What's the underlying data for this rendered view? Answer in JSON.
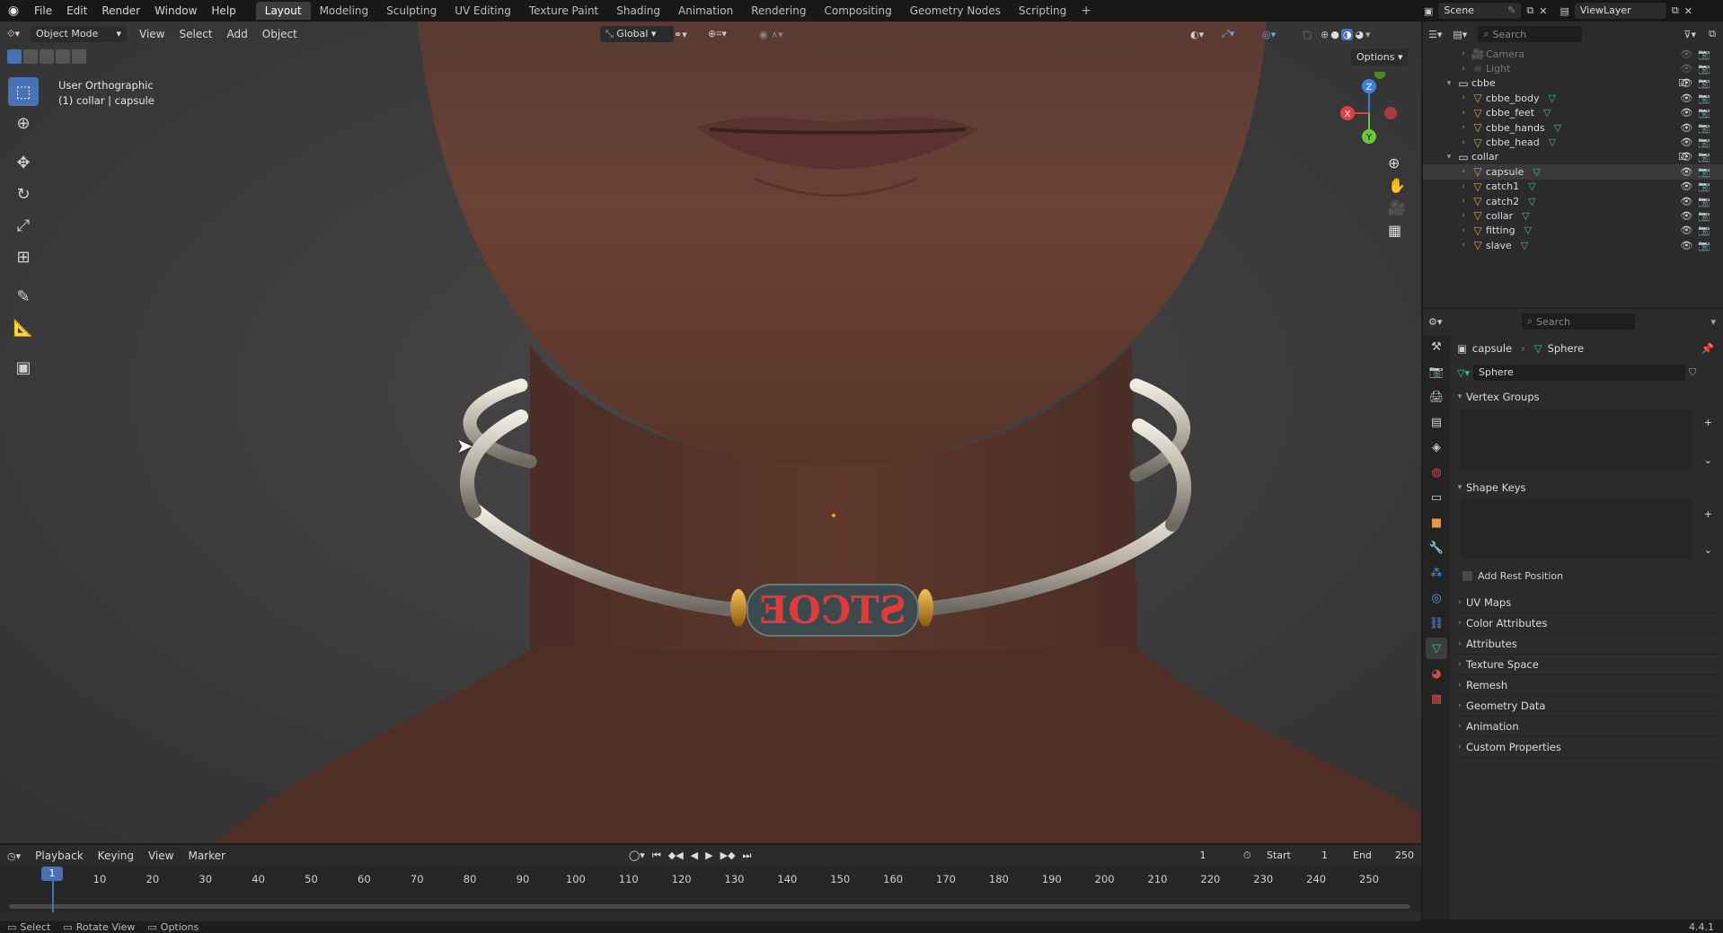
{
  "topbar": {
    "menus": [
      "File",
      "Edit",
      "Render",
      "Window",
      "Help"
    ],
    "workspaces": [
      "Layout",
      "Modeling",
      "Sculpting",
      "UV Editing",
      "Texture Paint",
      "Shading",
      "Animation",
      "Rendering",
      "Compositing",
      "Geometry Nodes",
      "Scripting"
    ],
    "active_workspace": "Layout",
    "add_tab": "+",
    "scene_label": "Scene",
    "viewlayer_label": "ViewLayer"
  },
  "viewport": {
    "mode": "Object Mode",
    "menus": [
      "View",
      "Select",
      "Add",
      "Object"
    ],
    "transform_orientation": "Global",
    "options_label": "Options",
    "view_name": "User Orthographic",
    "object_info": "(1) collar | capsule",
    "collar_text": "STCOE",
    "gizmo": {
      "x": "X",
      "y": "Y",
      "z": "Z"
    }
  },
  "outliner": {
    "search_placeholder": "Search",
    "rows": [
      {
        "label": "Camera",
        "type": "camera",
        "level": 1,
        "dim": true
      },
      {
        "label": "Light",
        "type": "light",
        "level": 1,
        "dim": true
      },
      {
        "label": "cbbe",
        "type": "collection",
        "level": 0
      },
      {
        "label": "cbbe_body",
        "type": "mesh",
        "level": 1
      },
      {
        "label": "cbbe_feet",
        "type": "mesh",
        "level": 1
      },
      {
        "label": "cbbe_hands",
        "type": "mesh",
        "level": 1
      },
      {
        "label": "cbbe_head",
        "type": "mesh",
        "level": 1
      },
      {
        "label": "collar",
        "type": "collection",
        "level": 0
      },
      {
        "label": "capsule",
        "type": "mesh",
        "level": 1
      },
      {
        "label": "catch1",
        "type": "mesh",
        "level": 1
      },
      {
        "label": "catch2",
        "type": "mesh",
        "level": 1
      },
      {
        "label": "collar",
        "type": "mesh",
        "level": 1
      },
      {
        "label": "fitting",
        "type": "mesh",
        "level": 1
      },
      {
        "label": "slave",
        "type": "mesh",
        "level": 1
      }
    ]
  },
  "properties": {
    "search_placeholder": "Search",
    "breadcrumb_object": "capsule",
    "breadcrumb_data": "Sphere",
    "mesh_name": "Sphere",
    "vertex_groups": "Vertex Groups",
    "shape_keys": "Shape Keys",
    "add_rest_position": "Add Rest Position",
    "sections": [
      "UV Maps",
      "Color Attributes",
      "Attributes",
      "Texture Space",
      "Remesh",
      "Geometry Data",
      "Animation",
      "Custom Properties"
    ]
  },
  "timeline": {
    "menus": [
      "Playback",
      "Keying",
      "View",
      "Marker"
    ],
    "current_frame": "1",
    "start_label": "Start",
    "start_value": "1",
    "end_label": "End",
    "end_value": "250",
    "ticks": [
      "1",
      "10",
      "20",
      "30",
      "40",
      "50",
      "60",
      "70",
      "80",
      "90",
      "100",
      "110",
      "120",
      "130",
      "140",
      "150",
      "160",
      "170",
      "180",
      "190",
      "200",
      "210",
      "220",
      "230",
      "240",
      "250"
    ]
  },
  "statusbar": {
    "select": "Select",
    "rotate": "Rotate View",
    "options": "Options",
    "version": "4.4.1"
  },
  "colors": {
    "accent": "#4772b3",
    "collar_text": "#e03a3a",
    "gold": "#d9a23a",
    "mesh_icon": "#e09a4a",
    "data_icon": "#3fbf7f"
  }
}
